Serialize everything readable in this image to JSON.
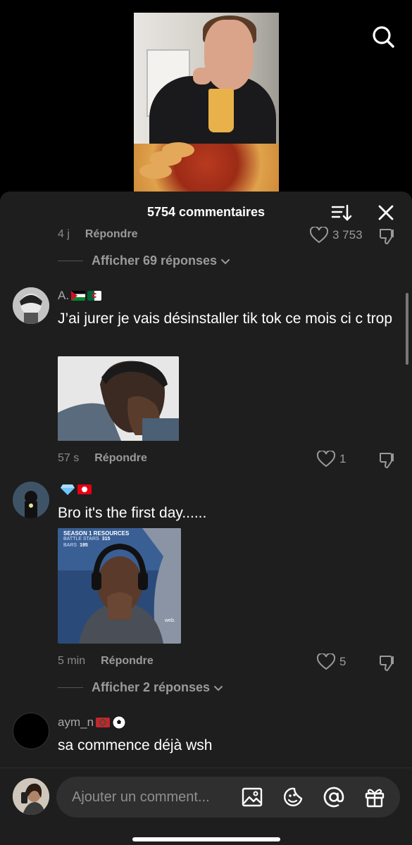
{
  "header": {
    "title": "5754 commentaires"
  },
  "icons": {
    "search": "search-icon",
    "sort": "sort-icon",
    "close": "close-icon",
    "heart": "heart-icon",
    "dislike": "dislike-icon",
    "image": "image-icon",
    "emoji": "emoji-icon",
    "mention": "at-icon",
    "gift": "gift-icon"
  },
  "previous_comment": {
    "time": "4 j",
    "reply": "Répondre",
    "likes": "3 753",
    "more_replies": "Afficher 69 réponses"
  },
  "comments": [
    {
      "username": "A.",
      "text": "J’ai jurer je vais désinstaller tik tok ce mois ci c trop",
      "time": "57 s",
      "reply": "Répondre",
      "likes": "1"
    },
    {
      "username": "",
      "text": "Bro it's the first day......",
      "gif_overlay": {
        "line1": "SEASON 1 RESOURCES",
        "line2": "BATTLE STARS",
        "line2_value": "315",
        "line3": "BARS",
        "line3_value": "195",
        "side": "web."
      },
      "time": "5 min",
      "reply": "Répondre",
      "likes": "5",
      "more_replies": "Afficher 2 réponses"
    },
    {
      "username": "aym_n",
      "text": "sa commence déjà wsh"
    }
  ],
  "composer": {
    "placeholder": "Ajouter un comment..."
  },
  "colors": {
    "sheet_bg": "#1e1e1e",
    "text_primary": "#ffffff",
    "text_secondary": "#8a8a8a",
    "input_bg": "#2f2f2f"
  }
}
